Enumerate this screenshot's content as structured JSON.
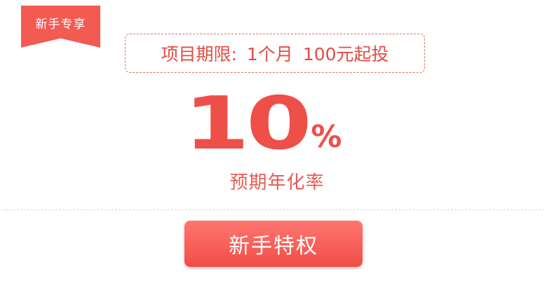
{
  "ribbon": {
    "label": "新手专享"
  },
  "term": {
    "prefix": "项目期限:",
    "duration": "1个月",
    "minimum": "100元起投"
  },
  "rate": {
    "value": "10",
    "unit": "%",
    "caption": "预期年化率"
  },
  "cta": {
    "label": "新手特权"
  },
  "colors": {
    "accent": "#f25a52",
    "button_top": "#ff7670",
    "button_bottom": "#f14d47"
  }
}
